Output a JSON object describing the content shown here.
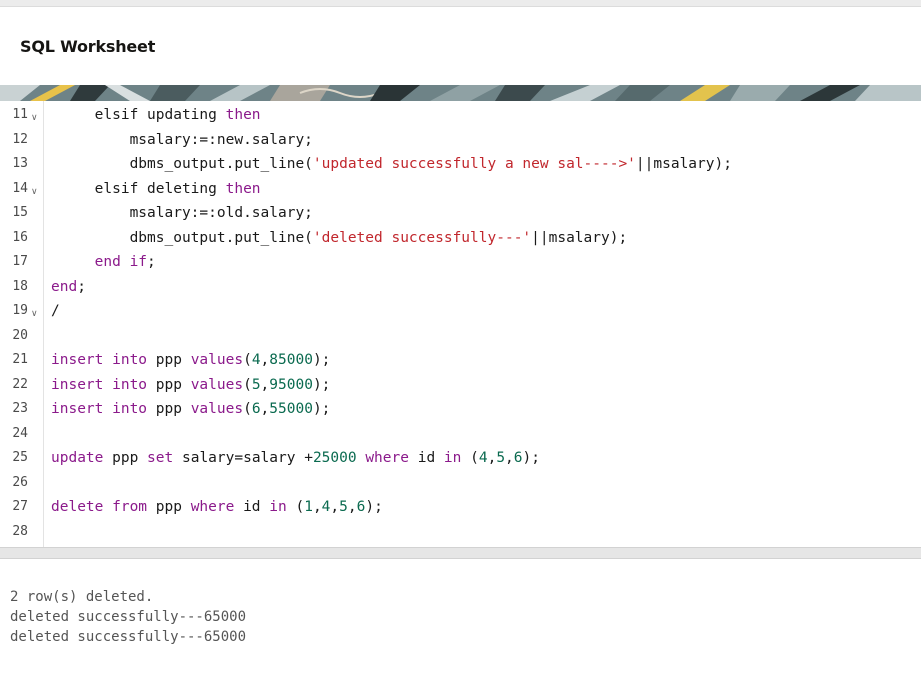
{
  "header": {
    "title": "SQL Worksheet"
  },
  "editor": {
    "lines": [
      {
        "n": "11",
        "fold": true,
        "indent": "     ",
        "tokens": [
          [
            "plain",
            "elsif updating "
          ],
          [
            "kw",
            "then"
          ]
        ]
      },
      {
        "n": "12",
        "fold": false,
        "indent": "         ",
        "tokens": [
          [
            "plain",
            "msalary:=:new.salary;"
          ]
        ]
      },
      {
        "n": "13",
        "fold": false,
        "indent": "         ",
        "tokens": [
          [
            "plain",
            "dbms_output.put_line("
          ],
          [
            "str",
            "'updated successfully a new sal---->'"
          ],
          [
            "plain",
            "||msalary);"
          ]
        ]
      },
      {
        "n": "14",
        "fold": true,
        "indent": "     ",
        "tokens": [
          [
            "plain",
            "elsif deleting "
          ],
          [
            "kw",
            "then"
          ]
        ]
      },
      {
        "n": "15",
        "fold": false,
        "indent": "         ",
        "tokens": [
          [
            "plain",
            "msalary:=:old.salary;"
          ]
        ]
      },
      {
        "n": "16",
        "fold": false,
        "indent": "         ",
        "tokens": [
          [
            "plain",
            "dbms_output.put_line("
          ],
          [
            "str",
            "'deleted successfully---'"
          ],
          [
            "plain",
            "||msalary);"
          ]
        ]
      },
      {
        "n": "17",
        "fold": false,
        "indent": "     ",
        "tokens": [
          [
            "kw",
            "end if"
          ],
          [
            "plain",
            ";"
          ]
        ]
      },
      {
        "n": "18",
        "fold": false,
        "indent": "",
        "tokens": [
          [
            "kw",
            "end"
          ],
          [
            "plain",
            ";"
          ]
        ]
      },
      {
        "n": "19",
        "fold": true,
        "indent": "",
        "tokens": [
          [
            "plain",
            "/"
          ]
        ]
      },
      {
        "n": "20",
        "fold": false,
        "indent": "",
        "tokens": []
      },
      {
        "n": "21",
        "fold": false,
        "indent": "",
        "tokens": [
          [
            "kw",
            "insert into"
          ],
          [
            "plain",
            " ppp "
          ],
          [
            "kw",
            "values"
          ],
          [
            "plain",
            "("
          ],
          [
            "num",
            "4"
          ],
          [
            "plain",
            ","
          ],
          [
            "num",
            "85000"
          ],
          [
            "plain",
            ");"
          ]
        ]
      },
      {
        "n": "22",
        "fold": false,
        "indent": "",
        "tokens": [
          [
            "kw",
            "insert into"
          ],
          [
            "plain",
            " ppp "
          ],
          [
            "kw",
            "values"
          ],
          [
            "plain",
            "("
          ],
          [
            "num",
            "5"
          ],
          [
            "plain",
            ","
          ],
          [
            "num",
            "95000"
          ],
          [
            "plain",
            ");"
          ]
        ]
      },
      {
        "n": "23",
        "fold": false,
        "indent": "",
        "tokens": [
          [
            "kw",
            "insert into"
          ],
          [
            "plain",
            " ppp "
          ],
          [
            "kw",
            "values"
          ],
          [
            "plain",
            "("
          ],
          [
            "num",
            "6"
          ],
          [
            "plain",
            ","
          ],
          [
            "num",
            "55000"
          ],
          [
            "plain",
            ");"
          ]
        ]
      },
      {
        "n": "24",
        "fold": false,
        "indent": "",
        "tokens": []
      },
      {
        "n": "25",
        "fold": false,
        "indent": "",
        "tokens": [
          [
            "kw",
            "update"
          ],
          [
            "plain",
            " ppp "
          ],
          [
            "kw",
            "set"
          ],
          [
            "plain",
            " salary=salary +"
          ],
          [
            "num",
            "25000"
          ],
          [
            "plain",
            " "
          ],
          [
            "kw",
            "where"
          ],
          [
            "plain",
            " id "
          ],
          [
            "kw",
            "in"
          ],
          [
            "plain",
            " ("
          ],
          [
            "num",
            "4"
          ],
          [
            "plain",
            ","
          ],
          [
            "num",
            "5"
          ],
          [
            "plain",
            ","
          ],
          [
            "num",
            "6"
          ],
          [
            "plain",
            ");"
          ]
        ]
      },
      {
        "n": "26",
        "fold": false,
        "indent": "",
        "tokens": []
      },
      {
        "n": "27",
        "fold": false,
        "indent": "",
        "tokens": [
          [
            "kw",
            "delete from"
          ],
          [
            "plain",
            " ppp "
          ],
          [
            "kw",
            "where"
          ],
          [
            "plain",
            " id "
          ],
          [
            "kw",
            "in"
          ],
          [
            "plain",
            " ("
          ],
          [
            "num",
            "1"
          ],
          [
            "plain",
            ","
          ],
          [
            "num",
            "4"
          ],
          [
            "plain",
            ","
          ],
          [
            "num",
            "5"
          ],
          [
            "plain",
            ","
          ],
          [
            "num",
            "6"
          ],
          [
            "plain",
            ");"
          ]
        ]
      },
      {
        "n": "28",
        "fold": false,
        "indent": "",
        "tokens": []
      }
    ]
  },
  "output": {
    "lines": [
      "2 row(s) deleted.",
      "deleted successfully---65000",
      "deleted successfully---65000"
    ]
  },
  "colors": {
    "keyword": "#8b1a8b",
    "string": "#c1272d",
    "number": "#0a6a4f"
  }
}
